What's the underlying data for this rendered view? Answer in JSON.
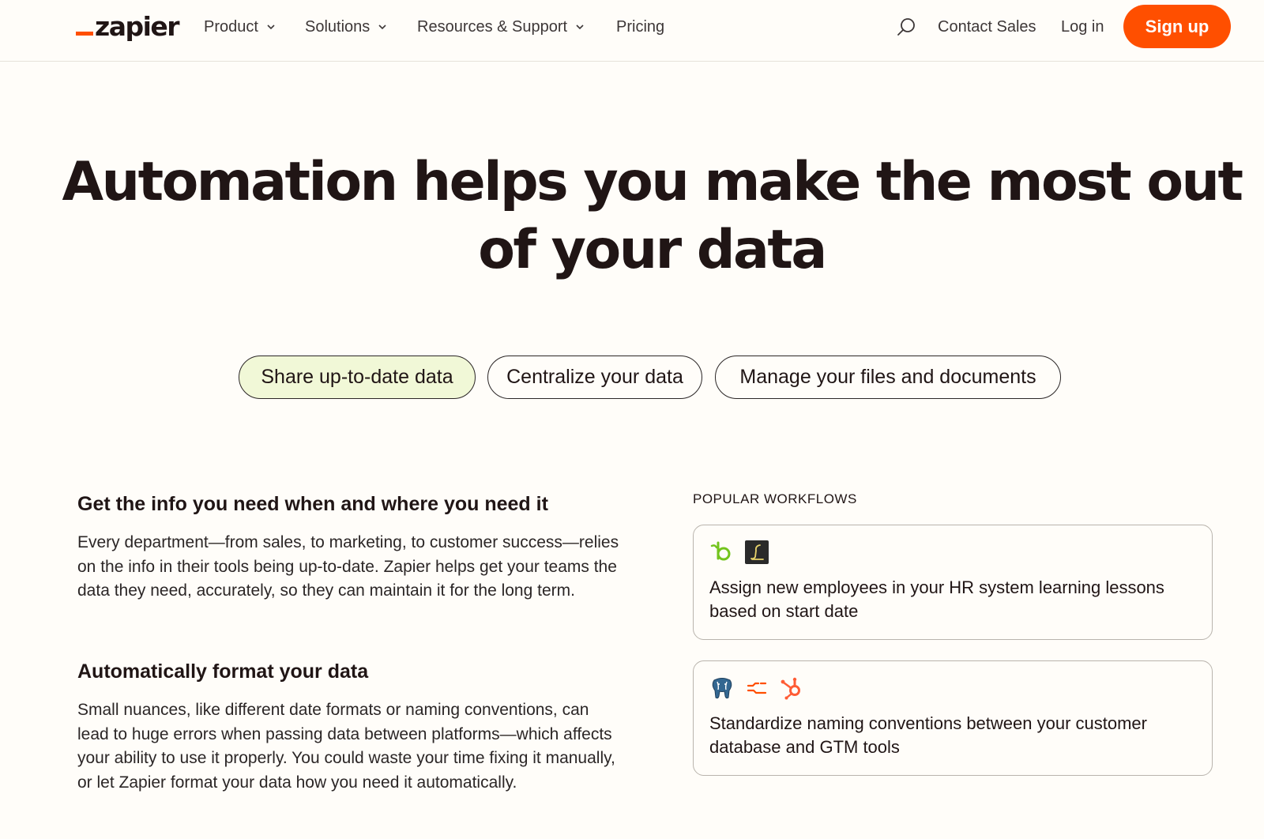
{
  "nav": {
    "logo_text": "zapier",
    "items": [
      {
        "label": "Product"
      },
      {
        "label": "Solutions"
      },
      {
        "label": "Resources & Support"
      },
      {
        "label": "Pricing"
      }
    ],
    "contact_sales": "Contact Sales",
    "login": "Log in",
    "signup": "Sign up"
  },
  "hero": {
    "title_line1": "Automation helps you make the most out",
    "title_line2": "of your data"
  },
  "tabs": [
    {
      "label": "Share up-to-date data",
      "active": true
    },
    {
      "label": "Centralize your data",
      "active": false
    },
    {
      "label": "Manage your files and documents",
      "active": false
    }
  ],
  "sections": [
    {
      "title": "Get the info you need when and where you need it",
      "body": "Every department—from sales, to marketing, to customer success—relies on the info in their tools being up-to-date. Zapier helps get your teams the data they need, accurately, so they can maintain it for the long term."
    },
    {
      "title": "Automatically format your data",
      "body": "Small nuances, like different date formats or naming conventions, can lead to huge errors when passing data between platforms—which affects your ability to use it properly. You could waste your time fixing it manually, or let Zapier format your data how you need it automatically."
    }
  ],
  "workflows": {
    "label": "POPULAR WORKFLOWS",
    "cards": [
      {
        "icons": [
          "bamboohr-icon",
          "lessonly-icon"
        ],
        "text": "Assign new employees in your HR system learning lessons based on start date"
      },
      {
        "icons": [
          "postgresql-icon",
          "formatter-icon",
          "hubspot-icon"
        ],
        "text": "Standardize naming conventions between your customer database and GTM tools"
      }
    ]
  },
  "colors": {
    "accent": "#ff4f00",
    "active_tab_bg": "#f1f8d7",
    "page_bg": "#fffdf9",
    "text": "#201515"
  }
}
